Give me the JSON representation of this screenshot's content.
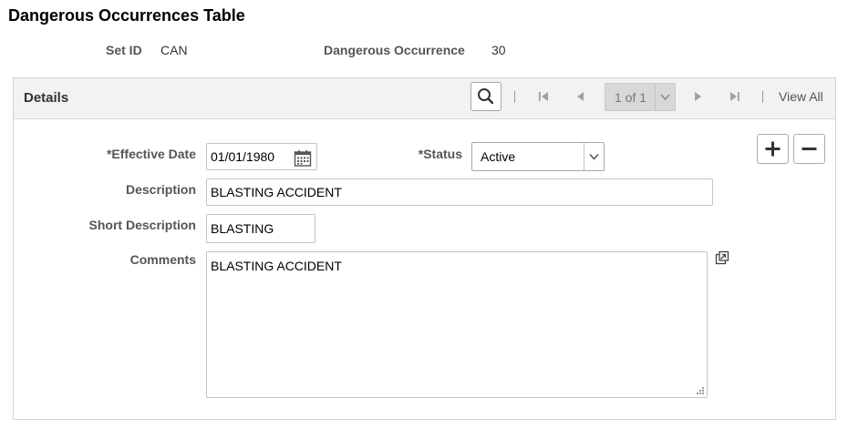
{
  "page": {
    "title": "Dangerous Occurrences Table"
  },
  "header": {
    "setid_label": "Set ID",
    "setid_value": "CAN",
    "occurrence_label": "Dangerous Occurrence",
    "occurrence_value": "30"
  },
  "details": {
    "title": "Details",
    "pagination": {
      "range": "1 of 1",
      "view_all": "View All"
    },
    "fields": {
      "effective_date_label": "*Effective Date",
      "effective_date_value": "01/01/1980",
      "status_label": "*Status",
      "status_value": "Active",
      "description_label": "Description",
      "description_value": "BLASTING ACCIDENT",
      "short_description_label": "Short Description",
      "short_description_value": "BLASTING",
      "comments_label": "Comments",
      "comments_value": "BLASTING ACCIDENT"
    }
  },
  "icons": {
    "search": "search-icon",
    "first": "first-page-icon",
    "prev": "previous-page-icon",
    "next": "next-page-icon",
    "last": "last-page-icon",
    "calendar": "calendar-icon",
    "add": "add-row-icon",
    "delete": "delete-row-icon",
    "expand": "expand-field-icon"
  }
}
